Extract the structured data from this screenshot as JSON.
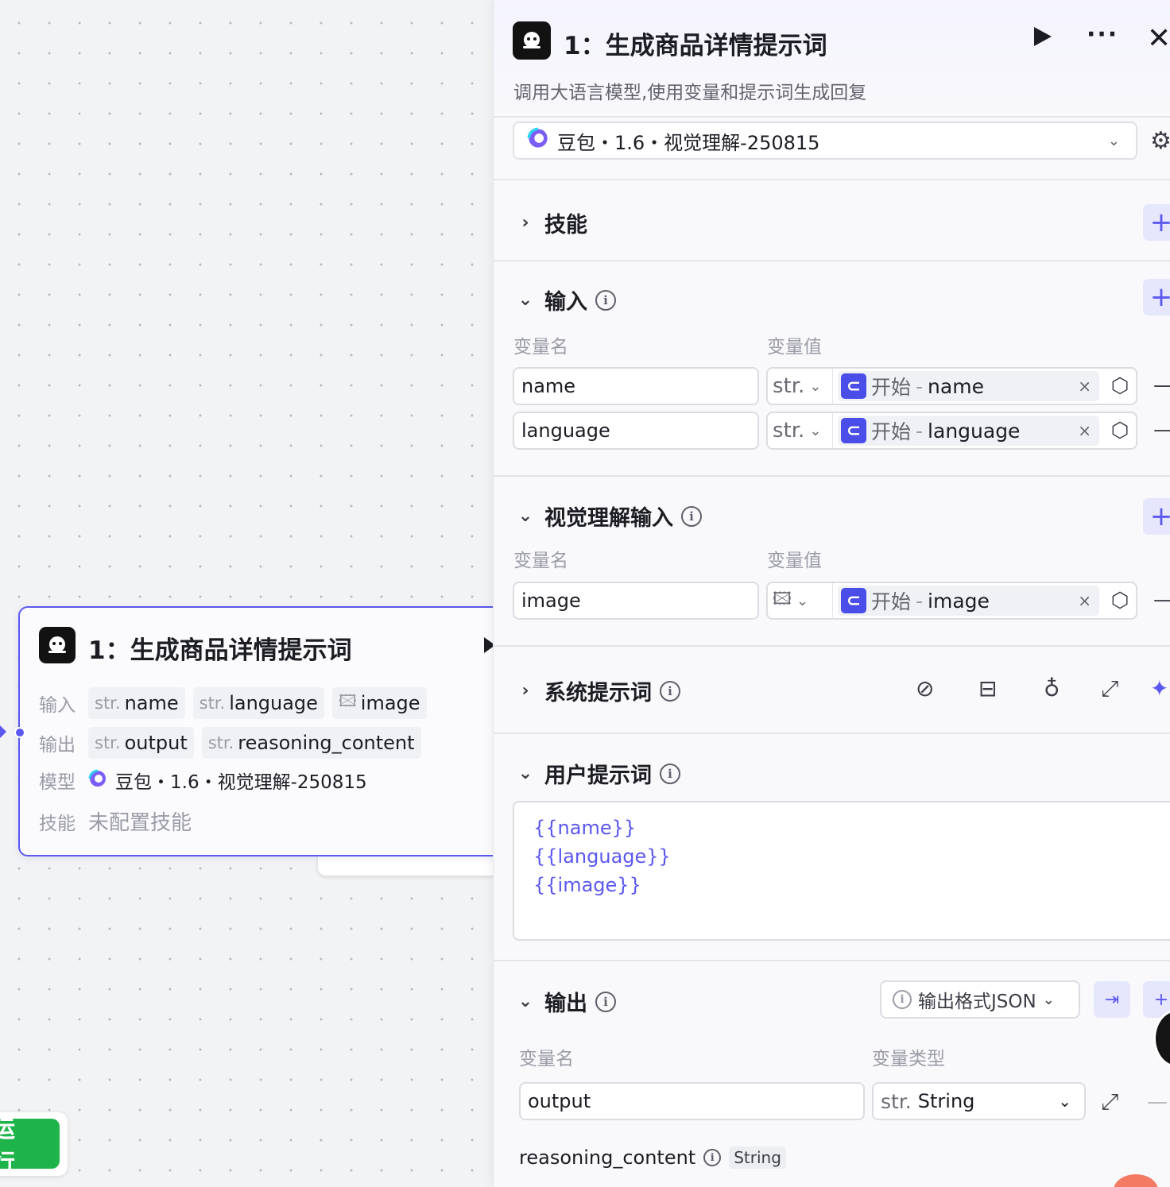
{
  "node": {
    "title": "1：生成商品详情提示词",
    "input_label": "输入",
    "inputs": [
      {
        "type": "str.",
        "name": "name"
      },
      {
        "type": "str.",
        "name": "language"
      },
      {
        "type": "image-icon",
        "name": "image"
      }
    ],
    "output_label": "输出",
    "outputs": [
      {
        "type": "str.",
        "name": "output"
      },
      {
        "type": "str.",
        "name": "reasoning_content"
      }
    ],
    "model_label": "模型",
    "model_name": "豆包・1.6・视觉理解-250815",
    "skill_label": "技能",
    "skill_value": "未配置技能"
  },
  "run_button": {
    "label": "运行",
    "color": "#1fb44a"
  },
  "panel": {
    "title": "1：生成商品详情提示词",
    "description": "调用大语言模型,使用变量和提示词生成回复",
    "model": {
      "name": "豆包・1.6・视觉理解-250815"
    },
    "skills": {
      "title": "技能"
    },
    "input": {
      "title": "输入",
      "col_name": "变量名",
      "col_value": "变量值",
      "rows": [
        {
          "name": "name",
          "type": "str.",
          "source": "开始",
          "sep": "-",
          "ref": "name"
        },
        {
          "name": "language",
          "type": "str.",
          "source": "开始",
          "sep": "-",
          "ref": "language"
        }
      ]
    },
    "vision_input": {
      "title": "视觉理解输入",
      "col_name": "变量名",
      "col_value": "变量值",
      "rows": [
        {
          "name": "image",
          "type": "image-icon",
          "source": "开始",
          "sep": "-",
          "ref": "image"
        }
      ]
    },
    "system_prompt": {
      "title": "系统提示词"
    },
    "user_prompt": {
      "title": "用户提示词",
      "lines": [
        "{{name}}",
        "{{language}}",
        "{{image}}"
      ]
    },
    "output": {
      "title": "输出",
      "format_button": "输出格式JSON",
      "col_name": "变量名",
      "col_type": "变量类型",
      "rows": [
        {
          "name": "output",
          "type_prefix": "str.",
          "type": "String"
        }
      ],
      "fixed": {
        "name": "reasoning_content",
        "type": "String"
      }
    }
  },
  "colors": {
    "accent": "#5b58f0",
    "ref_icon": "#4b4de9",
    "run": "#1fb44a"
  }
}
